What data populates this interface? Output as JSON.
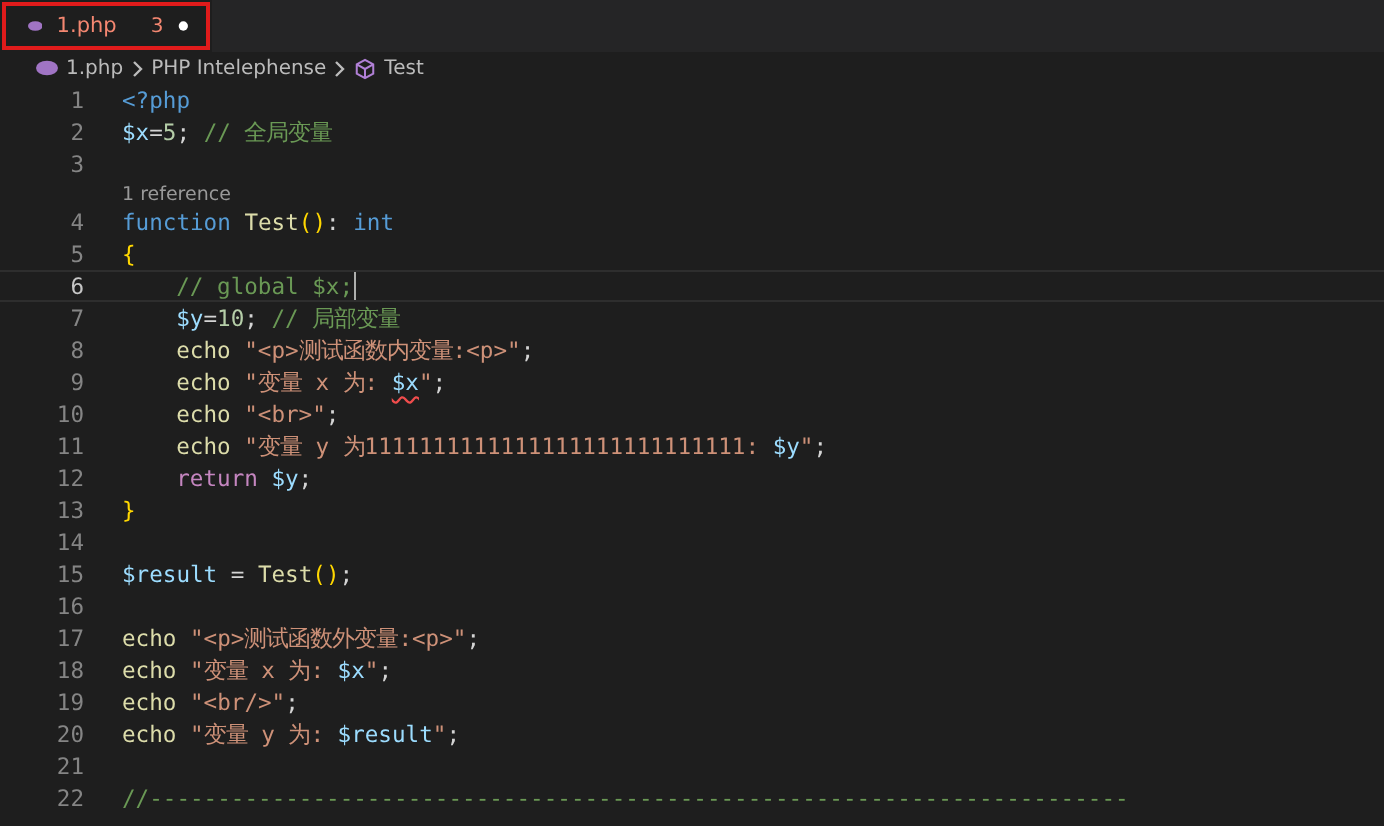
{
  "tabs": [
    {
      "label": "1.php",
      "problems": "3",
      "modified": true,
      "selected": true,
      "highlighted": true
    }
  ],
  "breadcrumb": [
    {
      "label": "1.php",
      "kind": "file"
    },
    {
      "label": "PHP Intelephense",
      "kind": "section"
    },
    {
      "label": "Test",
      "kind": "symbol"
    }
  ],
  "editor": {
    "lines": [
      {
        "number": "1",
        "current": false,
        "tokens": [
          {
            "kind": "keyword",
            "text": "<?php"
          }
        ]
      },
      {
        "number": "2",
        "current": false,
        "tokens": [
          {
            "kind": "var",
            "text": "$x"
          },
          {
            "kind": "plain",
            "text": "="
          },
          {
            "kind": "number",
            "text": "5"
          },
          {
            "kind": "plain",
            "text": ";"
          },
          {
            "kind": "comment",
            "text": "// 全局变量"
          }
        ]
      },
      {
        "number": "3",
        "current": false
      },
      {
        "number": "4",
        "current": false,
        "codelens": "1 reference",
        "tokens": [
          {
            "kind": "keyword",
            "text": "function"
          },
          {
            "kind": "func",
            "text": "Test"
          },
          {
            "kind": "bracket",
            "text": "()"
          },
          {
            "kind": "plain",
            "text": ":"
          },
          {
            "kind": "keyword",
            "text": "int"
          }
        ]
      },
      {
        "number": "5",
        "current": false,
        "tokens": [
          {
            "kind": "bracket",
            "text": "{"
          }
        ]
      },
      {
        "number": "6",
        "current": true,
        "tokens": [
          {
            "kind": "comment",
            "text": "// global $x;",
            "indent": true
          }
        ]
      },
      {
        "number": "7",
        "current": false,
        "tokens": [
          {
            "kind": "var",
            "text": "$y",
            "indent": true
          },
          {
            "kind": "plain",
            "text": "="
          },
          {
            "kind": "number",
            "text": "10"
          },
          {
            "kind": "plain",
            "text": ";"
          },
          {
            "kind": "comment",
            "text": "// 局部变量"
          }
        ]
      },
      {
        "number": "8",
        "current": false,
        "tokens": [
          {
            "kind": "func",
            "text": "echo",
            "indent": true
          },
          {
            "kind": "string",
            "text": "\"<p>测试函数内变量:<p>\""
          },
          {
            "kind": "plain",
            "text": ";"
          }
        ]
      },
      {
        "number": "9",
        "current": false,
        "tokens": [
          {
            "kind": "func",
            "text": "echo",
            "indent": true
          },
          {
            "kind": "string",
            "text": "\"变量 x 为:"
          },
          {
            "kind": "var",
            "text": "$x",
            "error": true
          },
          {
            "kind": "string",
            "text": "\""
          },
          {
            "kind": "plain",
            "text": ";"
          }
        ]
      },
      {
        "number": "10",
        "current": false,
        "tokens": [
          {
            "kind": "func",
            "text": "echo",
            "indent": true
          },
          {
            "kind": "string",
            "text": "\"<br>\""
          },
          {
            "kind": "plain",
            "text": ";"
          }
        ]
      },
      {
        "number": "11",
        "current": false,
        "tokens": [
          {
            "kind": "func",
            "text": "echo",
            "indent": true
          },
          {
            "kind": "string",
            "text": "\"变量 y 为1111111111111111111111111111:"
          },
          {
            "kind": "var",
            "text": "$y"
          },
          {
            "kind": "string",
            "text": "\""
          },
          {
            "kind": "plain",
            "text": ";"
          }
        ]
      },
      {
        "number": "12",
        "current": false,
        "tokens": [
          {
            "kind": "control",
            "text": "return",
            "indent": true
          },
          {
            "kind": "var",
            "text": "$y"
          },
          {
            "kind": "plain",
            "text": ";"
          }
        ]
      },
      {
        "number": "13",
        "current": false,
        "tokens": [
          {
            "kind": "bracket",
            "text": "}"
          }
        ]
      },
      {
        "number": "14",
        "current": false
      },
      {
        "number": "15",
        "current": false,
        "tokens": [
          {
            "kind": "var",
            "text": "$result"
          },
          {
            "kind": "plain",
            "text": "="
          },
          {
            "kind": "func",
            "text": "Test"
          },
          {
            "kind": "bracket",
            "text": "()"
          },
          {
            "kind": "plain",
            "text": ";"
          }
        ]
      },
      {
        "number": "16",
        "current": false
      },
      {
        "number": "17",
        "current": false,
        "tokens": [
          {
            "kind": "func",
            "text": "echo"
          },
          {
            "kind": "string",
            "text": "\"<p>测试函数外变量:<p>\""
          },
          {
            "kind": "plain",
            "text": ";"
          }
        ]
      },
      {
        "number": "18",
        "current": false,
        "tokens": [
          {
            "kind": "func",
            "text": "echo"
          },
          {
            "kind": "string",
            "text": "\"变量 x 为:"
          },
          {
            "kind": "var",
            "text": "$x"
          },
          {
            "kind": "string",
            "text": "\""
          },
          {
            "kind": "plain",
            "text": ";"
          }
        ]
      },
      {
        "number": "19",
        "current": false,
        "tokens": [
          {
            "kind": "func",
            "text": "echo"
          },
          {
            "kind": "string",
            "text": "\"<br/>\""
          },
          {
            "kind": "plain",
            "text": ";"
          }
        ]
      },
      {
        "number": "20",
        "current": false,
        "tokens": [
          {
            "kind": "func",
            "text": "echo"
          },
          {
            "kind": "string",
            "text": "\"变量 y 为:"
          },
          {
            "kind": "var",
            "text": "$result"
          },
          {
            "kind": "string",
            "text": "\""
          },
          {
            "kind": "plain",
            "text": ";"
          }
        ]
      },
      {
        "number": "21",
        "current": false
      },
      {
        "number": "22",
        "current": false,
        "tokens": [
          {
            "kind": "comment",
            "text": "//------------------------------------------------------------------------"
          }
        ]
      }
    ]
  }
}
